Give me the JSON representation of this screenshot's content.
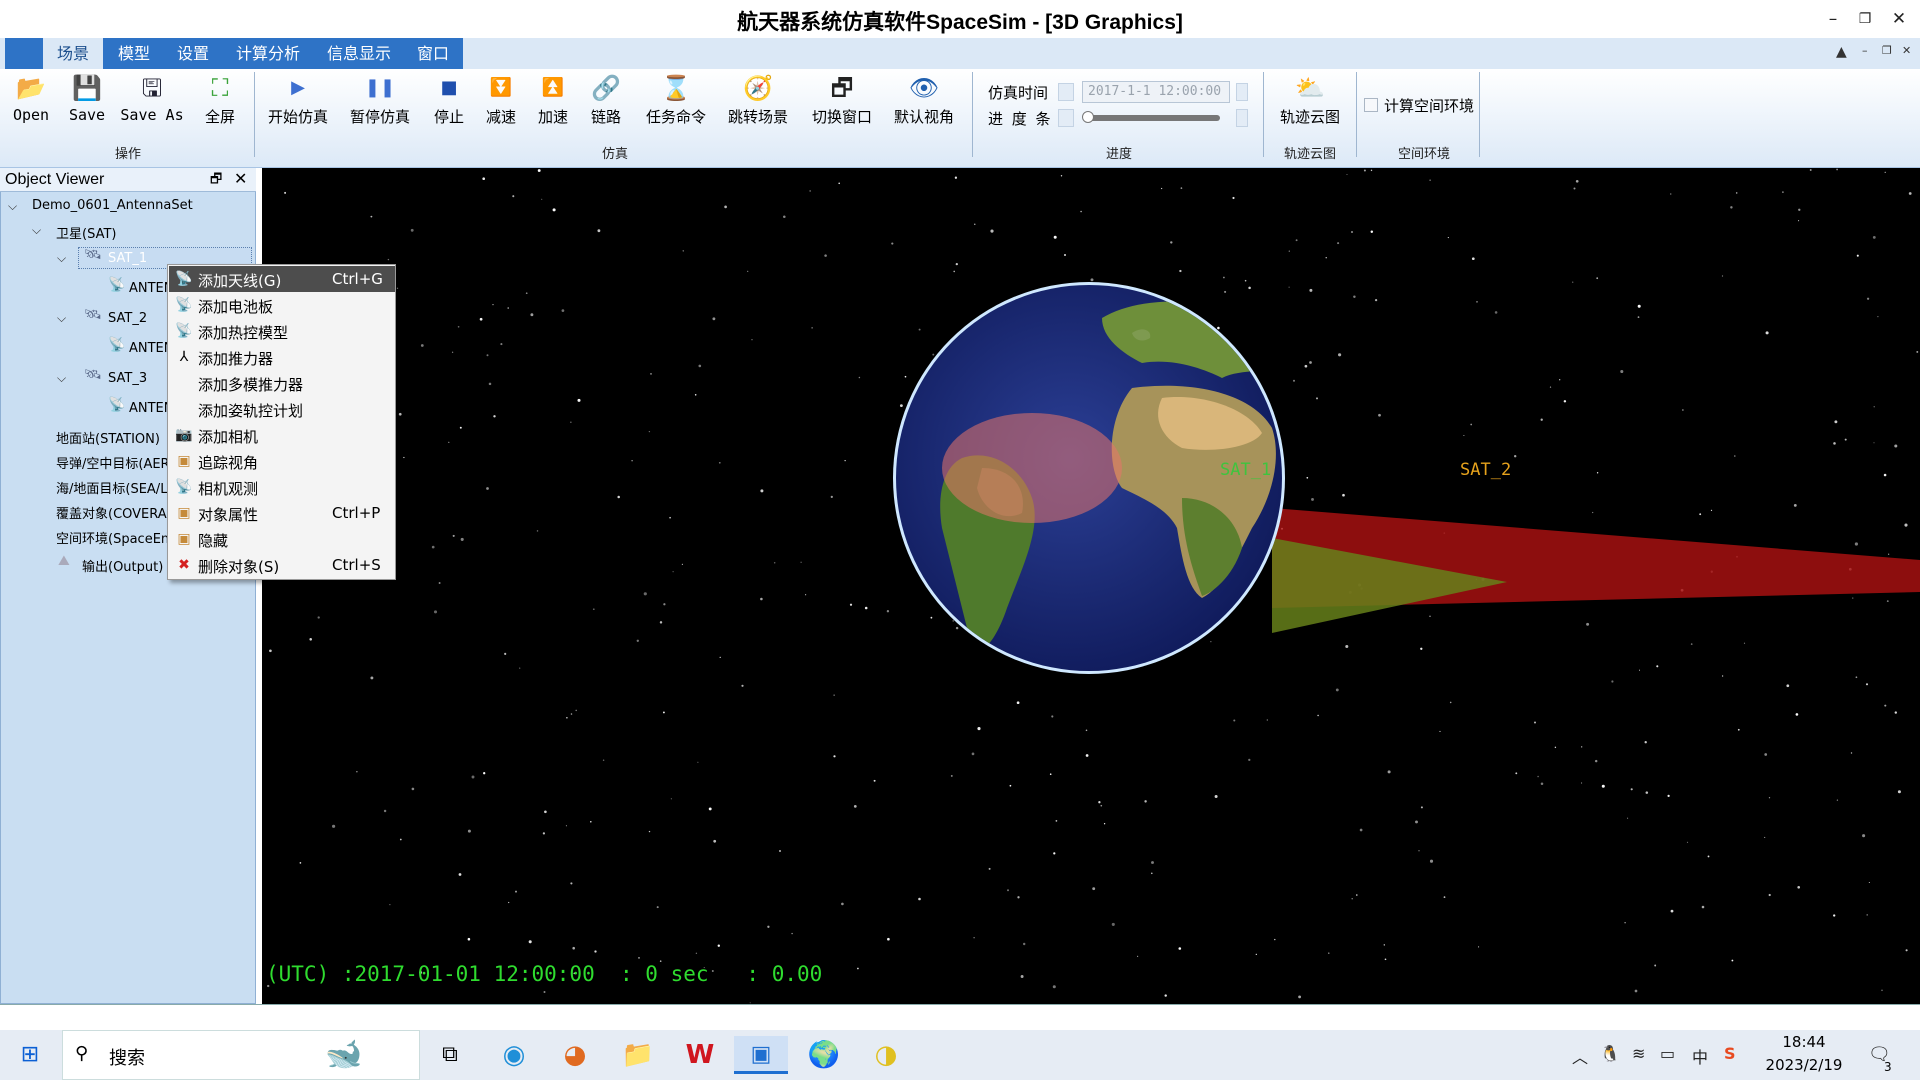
{
  "window": {
    "title": "航天器系统仿真软件SpaceSim - [3D Graphics]"
  },
  "tabs": [
    "场景",
    "模型",
    "设置",
    "计算分析",
    "信息显示",
    "窗口"
  ],
  "ribbon": {
    "ops": {
      "open": "Open",
      "save": "Save",
      "save_as": "Save As",
      "fullscreen": "全屏",
      "group": "操作"
    },
    "sim": {
      "start": "开始仿真",
      "pause": "暂停仿真",
      "stop": "停止",
      "slow": "减速",
      "fast": "加速",
      "link": "链路",
      "task": "任务命令",
      "jump": "跳转场景",
      "switch": "切换窗口",
      "default_view": "默认视角",
      "group": "仿真"
    },
    "progress": {
      "time_label": "仿真时间",
      "time_value": "2017-1-1 12:00:00",
      "bar_label": "进 度 条",
      "level": 0,
      "group": "进度"
    },
    "cloud": {
      "label": "轨迹云图",
      "group": "轨迹云图"
    },
    "space": {
      "label": "计算空间环境",
      "checked": false,
      "group": "空间环境"
    }
  },
  "object_viewer": {
    "title": "Object Viewer",
    "root": "Demo_0601_AntennaSet",
    "sat_group": "卫星(SAT)",
    "sats": [
      "SAT_1",
      "SAT_2",
      "SAT_3"
    ],
    "antenna": "ANTENNA",
    "categories": [
      "地面站(STATION)",
      "导弹/空中目标(AERO)",
      "海/地面目标(SEA/LAND)",
      "覆盖对象(COVERAGE)",
      "空间环境(SpaceEnv)",
      "输出(Output)"
    ]
  },
  "context_menu": {
    "items": [
      {
        "label": "添加天线(G)",
        "shortcut": "Ctrl+G",
        "icon": "antenna-icon",
        "highlighted": true
      },
      {
        "label": "添加电池板",
        "shortcut": "",
        "icon": "antenna-icon"
      },
      {
        "label": "添加热控模型",
        "shortcut": "",
        "icon": "antenna-icon"
      },
      {
        "label": "添加推力器",
        "shortcut": "",
        "icon": "thruster-icon"
      },
      {
        "label": "添加多模推力器",
        "shortcut": "",
        "icon": ""
      },
      {
        "label": "添加姿轨控计划",
        "shortcut": "",
        "icon": ""
      },
      {
        "label": "添加相机",
        "shortcut": "",
        "icon": "camera-icon"
      },
      {
        "label": "追踪视角",
        "shortcut": "",
        "icon": "cube-icon"
      },
      {
        "label": "相机观测",
        "shortcut": "",
        "icon": "antenna-icon"
      },
      {
        "label": "对象属性",
        "shortcut": "Ctrl+P",
        "icon": "cube-icon"
      },
      {
        "label": "隐藏",
        "shortcut": "",
        "icon": "cube-icon"
      },
      {
        "label": "删除对象(S)",
        "shortcut": "Ctrl+S",
        "icon": "delete-icon"
      }
    ]
  },
  "view3d": {
    "labels": {
      "sat1": "SAT_1",
      "sat2": "SAT_2"
    },
    "status": "(UTC) :2017-01-01 12:00:00  : 0 sec   : 0.00",
    "colors": {
      "status": "#2fdc2f",
      "sat1_label": "#3ec43e",
      "sat2_label": "#e6a21c"
    }
  },
  "taskbar": {
    "search": "搜索",
    "time": "18:44",
    "date": "2023/2/19",
    "ime": "中",
    "notifications": "3"
  }
}
